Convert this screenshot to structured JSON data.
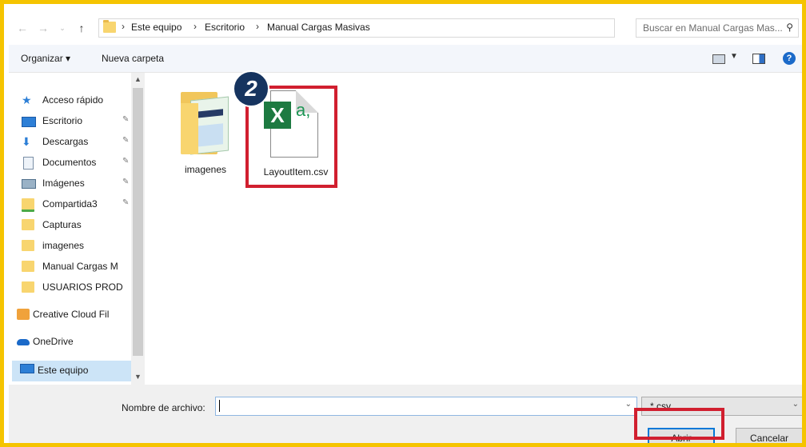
{
  "address": {
    "crumbs": [
      "Este equipo",
      "Escritorio",
      "Manual Cargas Masivas"
    ],
    "search_placeholder": "Buscar en Manual Cargas Mas..."
  },
  "toolbar": {
    "organize": "Organizar ▾",
    "new_folder": "Nueva carpeta"
  },
  "nav": {
    "items": [
      {
        "label": "Acceso rápido",
        "icon": "star-icon"
      },
      {
        "label": "Escritorio",
        "icon": "desktop-icon",
        "pinned": true
      },
      {
        "label": "Descargas",
        "icon": "download-icon",
        "pinned": true
      },
      {
        "label": "Documentos",
        "icon": "document-icon",
        "pinned": true
      },
      {
        "label": "Imágenes",
        "icon": "picture-icon",
        "pinned": true
      },
      {
        "label": "Compartida3",
        "icon": "shared-folder-icon",
        "pinned": true
      },
      {
        "label": "Capturas",
        "icon": "folder-icon"
      },
      {
        "label": "imagenes",
        "icon": "folder-icon"
      },
      {
        "label": "Manual Cargas M",
        "icon": "folder-icon"
      },
      {
        "label": "USUARIOS PROD",
        "icon": "folder-icon"
      },
      {
        "label": "Creative Cloud Fil",
        "icon": "creative-cloud-icon"
      },
      {
        "label": "OneDrive",
        "icon": "onedrive-icon"
      },
      {
        "label": "Este equipo",
        "icon": "computer-icon",
        "selected": true
      }
    ]
  },
  "files": [
    {
      "name": "imagenes",
      "type": "folder"
    },
    {
      "name": "LayoutItem.csv",
      "type": "csv"
    }
  ],
  "icon_glyphs": {
    "csv_x": "X",
    "csv_a": "a,"
  },
  "annotation": {
    "step": "2",
    "color": "#d11f2f",
    "badge_color": "#16345f"
  },
  "bottom": {
    "filename_label": "Nombre de archivo:",
    "filename_value": "",
    "filter": "*.csv",
    "open_button": "Abrir",
    "cancel_button": "Cancelar"
  }
}
